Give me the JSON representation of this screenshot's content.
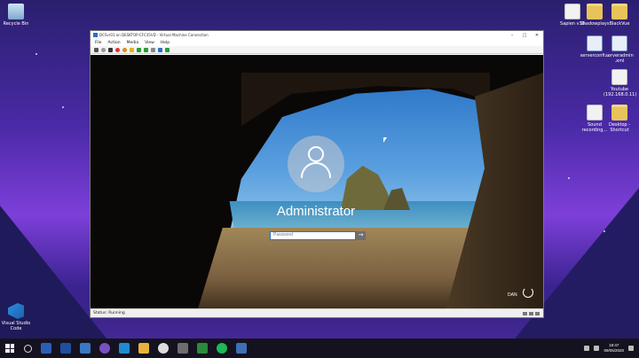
{
  "desktop": {
    "icons_left": [
      {
        "label": "Recycle Bin",
        "icon": "recycle-bin-icon"
      },
      {
        "label": "Visual Studio Code",
        "icon": "vscode-icon"
      }
    ],
    "icons_right": [
      {
        "label": "Sapien v18",
        "icon": "file-icon"
      },
      {
        "label": "Shadowplays",
        "icon": "folder-icon"
      },
      {
        "label": "BlackVue",
        "icon": "folder-icon"
      },
      {
        "label": "serverconfi...",
        "icon": "xml-file-icon"
      },
      {
        "label": "serveradmin .xml",
        "icon": "xml-file-icon"
      },
      {
        "label": "Youtube (192.168.0.11)",
        "icon": "network-drive-icon"
      },
      {
        "label": "Sound recording...",
        "icon": "file-icon"
      },
      {
        "label": "Desktop - Shortcut",
        "icon": "folder-icon"
      }
    ]
  },
  "vm_window": {
    "title": "DCSvr01 on DESKTOP-CFC35VD - Virtual Machine Connection",
    "menu": [
      "File",
      "Action",
      "Media",
      "View",
      "Help"
    ],
    "status": "Status: Running",
    "login": {
      "username": "Administrator",
      "password_placeholder": "Password",
      "language": "DAN"
    }
  },
  "taskbar": {
    "time": "18:47",
    "date": "09/05/2020"
  },
  "colors": {
    "accent": "#2a6fc9",
    "taskbar": "#15121f"
  }
}
